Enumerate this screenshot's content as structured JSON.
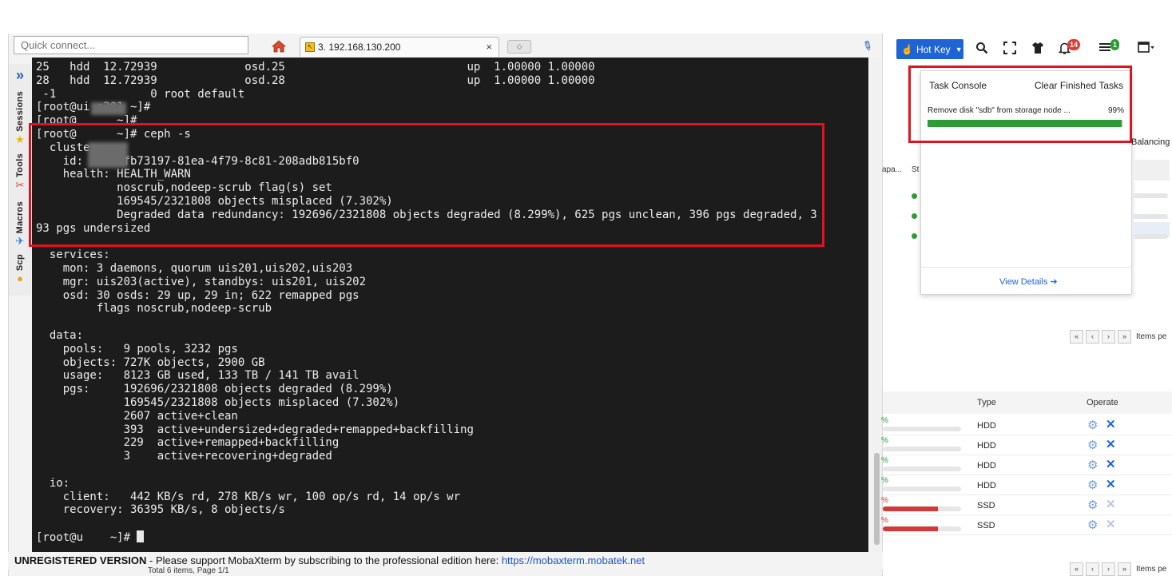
{
  "moba": {
    "quick_connect_placeholder": "Quick connect...",
    "tab_title": "3. 192.168.130.200",
    "tab_close": "×",
    "new_tab": "◇",
    "side_tabs": [
      {
        "label": "Sessions",
        "icon": "★"
      },
      {
        "label": "Tools",
        "icon": "✂"
      },
      {
        "label": "Macros",
        "icon": "✈"
      },
      {
        "label": "Scp",
        "icon": "●"
      }
    ],
    "terminal_lines": [
      "25   hdd  12.72939             osd.25                           up  1.00000 1.00000",
      "28   hdd  12.72939             osd.28                           up  1.00000 1.00000",
      " -1              0 root default",
      "[root@ui s201 ~]#",
      "[root@      ~]#",
      "[root@      ~]# ceph -s",
      "  cluster:",
      "    id:     2fb73197-81ea-4f79-8c81-208adb815bf0",
      "    health: HEALTH_WARN",
      "            noscrub,nodeep-scrub flag(s) set",
      "            169545/2321808 objects misplaced (7.302%)",
      "            Degraded data redundancy: 192696/2321808 objects degraded (8.299%), 625 pgs unclean, 396 pgs degraded, 3",
      "93 pgs undersized",
      "",
      "  services:",
      "    mon: 3 daemons, quorum uis201,uis202,uis203",
      "    mgr: uis203(active), standbys: uis201, uis202",
      "    osd: 30 osds: 29 up, 29 in; 622 remapped pgs",
      "         flags noscrub,nodeep-scrub",
      "",
      "  data:",
      "    pools:   9 pools, 3232 pgs",
      "    objects: 727K objects, 2900 GB",
      "    usage:   8123 GB used, 133 TB / 141 TB avail",
      "    pgs:     192696/2321808 objects degraded (8.299%)",
      "             169545/2321808 objects misplaced (7.302%)",
      "             2607 active+clean",
      "             393  active+undersized+degraded+remapped+backfilling",
      "             229  active+remapped+backfilling",
      "             3    active+recovering+degraded",
      "",
      "  io:",
      "    client:   442 KB/s rd, 278 KB/s wr, 100 op/s rd, 14 op/s wr",
      "    recovery: 36395 KB/s, 8 objects/s",
      "",
      "[root@u    ~]# "
    ],
    "unregistered_label": "UNREGISTERED VERSION",
    "unregistered_text": " -  Please support MobaXterm by subscribing to the professional edition here:  ",
    "unregistered_link": "https://mobaxterm.mobatek.net"
  },
  "web": {
    "hotkey_label": "Hot Key",
    "notification_count": "14",
    "task_count": "1",
    "task_console": {
      "title": "Task Console",
      "clear_label": "Clear Finished Tasks",
      "task_name": "Remove disk \"sdb\" from storage node ...",
      "progress_text": "99%",
      "progress": 0.99,
      "details_label": "View Details"
    },
    "balancing": "Balancing",
    "col_capa": "apa...",
    "col_st": "St",
    "items_per_page": "Items pe",
    "items_per_page_2": "Items pe",
    "disk_headers": {
      "type": "Type",
      "operate": "Operate"
    },
    "disks": [
      {
        "pct": "%",
        "type": "HDD",
        "fill": 0.0,
        "color": "#2c9d35",
        "x_color": "#1e64d4"
      },
      {
        "pct": "%",
        "type": "HDD",
        "fill": 0.0,
        "color": "#2c9d35",
        "x_color": "#1e64d4"
      },
      {
        "pct": "%",
        "type": "HDD",
        "fill": 0.0,
        "color": "#2c9d35",
        "x_color": "#1e64d4"
      },
      {
        "pct": "%",
        "type": "HDD",
        "fill": 0.0,
        "color": "#2c9d35",
        "x_color": "#1e64d4"
      },
      {
        "pct": "%",
        "type": "SSD",
        "fill": 0.7,
        "color": "#d23a3a",
        "x_color": "#b9c7dc"
      },
      {
        "pct": "%",
        "type": "SSD",
        "fill": 0.7,
        "color": "#d23a3a",
        "x_color": "#b9c7dc"
      }
    ],
    "footer_total": "Total 6 items, Page 1/1"
  }
}
